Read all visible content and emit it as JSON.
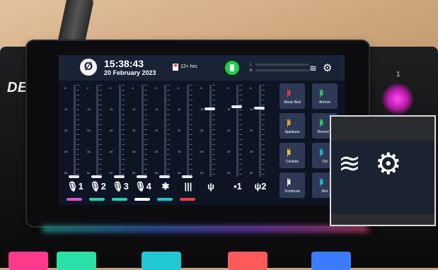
{
  "status_bar": {
    "logo_glyph": "Ø",
    "time": "15:38:43",
    "date": "20 February 2023",
    "record_time": "12+ hrs",
    "meter_left": "L",
    "meter_right": "R"
  },
  "brand": {
    "text": "DE",
    "knob_number": "1"
  },
  "channels": [
    {
      "label": "🎙1",
      "color": "#e24fd0",
      "fader_level": 0.0
    },
    {
      "label": "🎙2",
      "color": "#19d9b4",
      "fader_level": 0.0
    },
    {
      "label": "🎙3",
      "color": "#19d9b4",
      "fader_level": 0.0
    },
    {
      "label": "🎙4",
      "color": "#ffffff",
      "fader_level": 0.0
    },
    {
      "label": "✱",
      "color": "#19c6d9",
      "fader_level": 0.0
    },
    {
      "label": "|||",
      "color": "#ff3b3b",
      "fader_level": 0.0
    },
    {
      "label": "ψ",
      "color": "",
      "fader_level": 0.75
    },
    {
      "label": "▪1",
      "color": "",
      "fader_level": 0.77
    },
    {
      "label": "ψ2",
      "color": "",
      "fader_level": 0.76
    }
  ],
  "fader_ticks": [
    "0",
    "15",
    "30",
    "45",
    "60"
  ],
  "sound_pads": [
    {
      "label": "Music Bed",
      "color": "#ff3a3a"
    },
    {
      "label": "Airhorn",
      "color": "#2cdc5c"
    },
    {
      "label": "Applause",
      "color": "#ffb020"
    },
    {
      "label": "Record S",
      "color": "#2cdc5c"
    },
    {
      "label": "Crickets",
      "color": "#ffd040"
    },
    {
      "label": "Chi",
      "color": "#19c6d9"
    },
    {
      "label": "Trombone",
      "color": "#ffffff"
    },
    {
      "label": "Rim",
      "color": "#19c6d9"
    }
  ],
  "zoom_inset": {
    "wifi_glyph": "⦿",
    "gear_glyph": "⚙"
  }
}
